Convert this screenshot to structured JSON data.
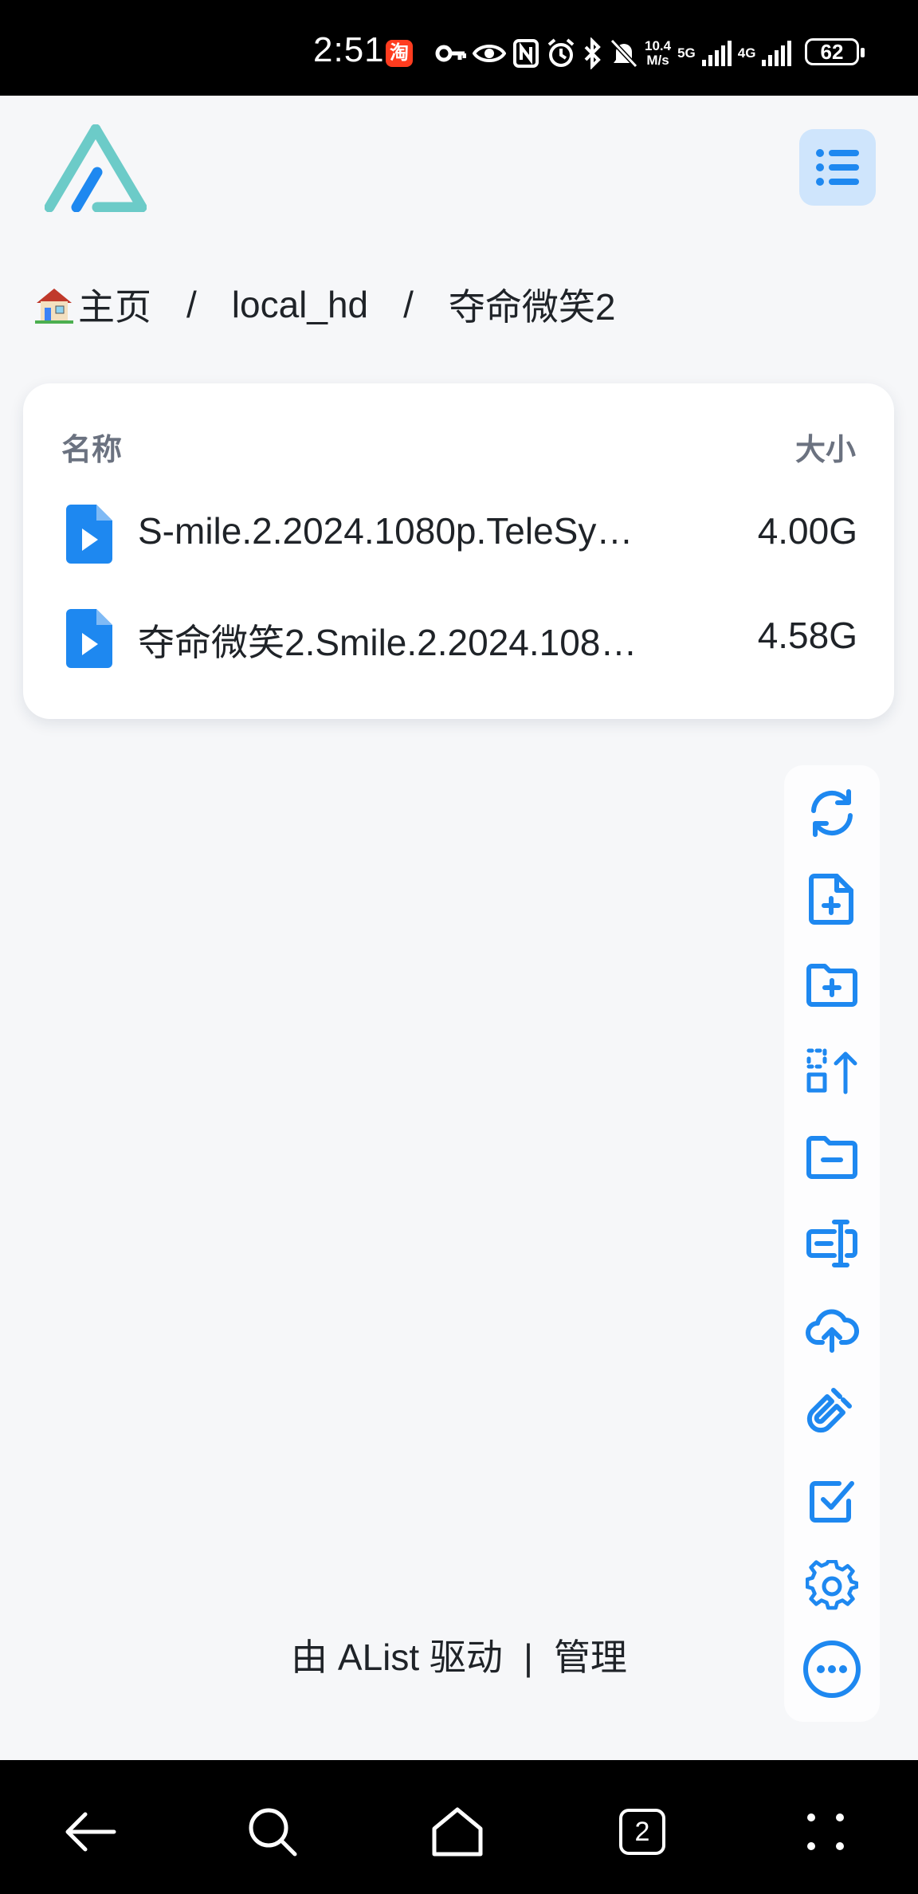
{
  "status_bar": {
    "time": "2:51",
    "app_badge": "淘",
    "net_speed_top": "10.4",
    "net_speed_bottom": "M/s",
    "sim1_label": "5G",
    "sim2_label": "4G",
    "battery": "62"
  },
  "header": {
    "logo": "alist-logo",
    "menu_icon": "list-menu-icon"
  },
  "breadcrumb": {
    "home_icon": "house-icon",
    "home": "主页",
    "separator": "/",
    "level1": "local_hd",
    "level2": "夺命微笑2"
  },
  "file_list": {
    "col_name": "名称",
    "col_size": "大小",
    "rows": [
      {
        "name": "S-mile.2.2024.1080p.TeleSy…",
        "size": "4.00G",
        "icon": "video-file-icon"
      },
      {
        "name": "夺命微笑2.Smile.2.2024.108…",
        "size": "4.58G",
        "icon": "video-file-icon"
      }
    ]
  },
  "actions": [
    {
      "name": "refresh",
      "icon": "refresh-icon"
    },
    {
      "name": "new-file",
      "icon": "file-plus-icon"
    },
    {
      "name": "new-folder",
      "icon": "folder-plus-icon"
    },
    {
      "name": "recursive-move",
      "icon": "select-up-icon"
    },
    {
      "name": "remove-empty-folder",
      "icon": "folder-minus-icon"
    },
    {
      "name": "batch-rename",
      "icon": "rename-icon"
    },
    {
      "name": "upload",
      "icon": "cloud-upload-icon"
    },
    {
      "name": "offline-download",
      "icon": "magnet-icon"
    },
    {
      "name": "select",
      "icon": "checkbox-icon"
    },
    {
      "name": "settings",
      "icon": "gear-icon"
    },
    {
      "name": "more",
      "icon": "more-icon"
    }
  ],
  "footer": {
    "powered": "由 AList 驱动",
    "pipe": "|",
    "manage": "管理"
  },
  "nav": {
    "tabs_count": "2"
  },
  "colors": {
    "accent": "#1e88f0",
    "logo_teal": "#6ccbc8",
    "logo_blue": "#1e88f0",
    "background": "#f6f7f9"
  }
}
